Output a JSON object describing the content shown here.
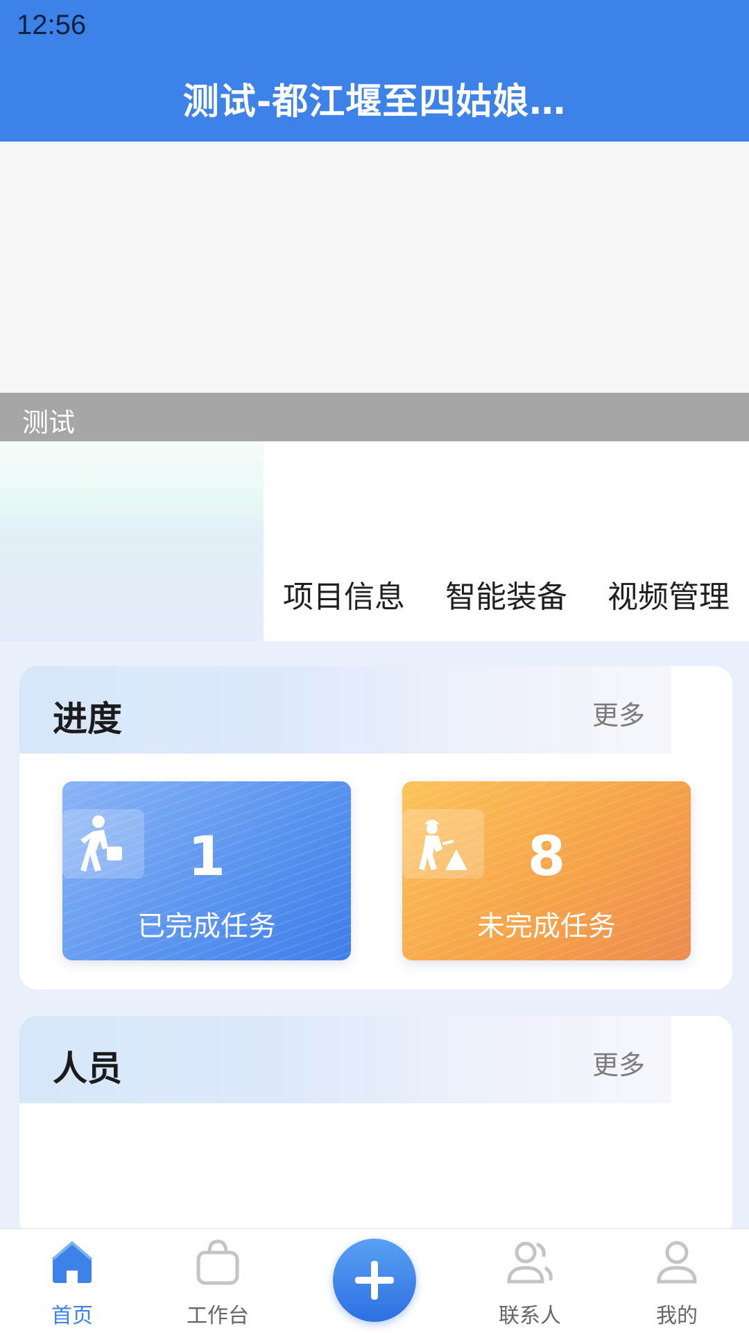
{
  "status_bar": {
    "time": "12:56"
  },
  "header": {
    "title": "测试-都江堰至四姑娘…"
  },
  "banner": {
    "caption": "测试"
  },
  "tabs": [
    {
      "label": "项目信息"
    },
    {
      "label": "智能装备"
    },
    {
      "label": "视频管理"
    }
  ],
  "progress": {
    "title": "进度",
    "more": "更多",
    "completed": {
      "count": "1",
      "label": "已完成任务",
      "icon": "worker-walking-icon"
    },
    "incomplete": {
      "count": "8",
      "label": "未完成任务",
      "icon": "construction-worker-icon"
    }
  },
  "personnel": {
    "title": "人员",
    "more": "更多"
  },
  "bottom_nav": {
    "items": [
      {
        "label": "首页",
        "icon": "home-icon",
        "active": true
      },
      {
        "label": "工作台",
        "icon": "bag-icon"
      },
      {
        "label": "联系人",
        "icon": "contacts-icon"
      },
      {
        "label": "我的",
        "icon": "user-icon"
      }
    ],
    "add_icon": "plus-icon"
  },
  "colors": {
    "primary": "#3c82e8",
    "completed_card": "#5b95ef",
    "incomplete_card": "#f6a449"
  }
}
